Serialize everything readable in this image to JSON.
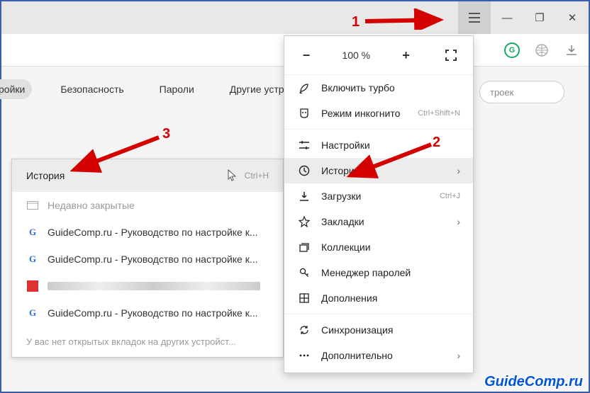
{
  "titlebar": {
    "minimize": "—",
    "maximize": "❐",
    "close": "✕"
  },
  "addrbar": {
    "g": "G"
  },
  "tabs": [
    "ройки",
    "Безопасность",
    "Пароли",
    "Другие устройства"
  ],
  "search": {
    "placeholder": "троек"
  },
  "zoom": {
    "minus": "−",
    "value": "100 %",
    "plus": "+"
  },
  "menu": {
    "turbo": "Включить турбо",
    "incognito": "Режим инкогнито",
    "incognito_sc": "Ctrl+Shift+N",
    "settings": "Настройки",
    "history": "История",
    "downloads": "Загрузки",
    "downloads_sc": "Ctrl+J",
    "bookmarks": "Закладки",
    "collections": "Коллекции",
    "passwords": "Менеджер паролей",
    "addons": "Дополнения",
    "sync": "Синхронизация",
    "more": "Дополнительно"
  },
  "submenu": {
    "title": "История",
    "shortcut": "Ctrl+H",
    "recent": "Недавно закрытые",
    "items": [
      "GuideComp.ru - Руководство по настройке к...",
      "GuideComp.ru - Руководство по настройке к...",
      "",
      "GuideComp.ru - Руководство по настройке к..."
    ],
    "footer": "У вас нет открытых вкладок на других устройст..."
  },
  "annot": {
    "n1": "1",
    "n2": "2",
    "n3": "3"
  },
  "watermark": "GuideComp.ru"
}
